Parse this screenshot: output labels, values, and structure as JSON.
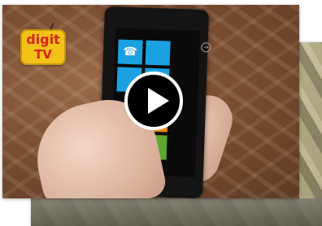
{
  "logo": {
    "line1": "digit",
    "line2": "TV"
  },
  "phone_screen": {
    "tile_labels": [
      "☎",
      "",
      "",
      "",
      "",
      "",
      ""
    ]
  },
  "play_button": {
    "icon": "play-icon"
  },
  "colors": {
    "tile_blue": "#1ba1e2",
    "tile_orange": "#e88a20",
    "tile_green": "#5ca82a",
    "logo_yellow": "#f2c218",
    "logo_red": "#d8231a"
  }
}
